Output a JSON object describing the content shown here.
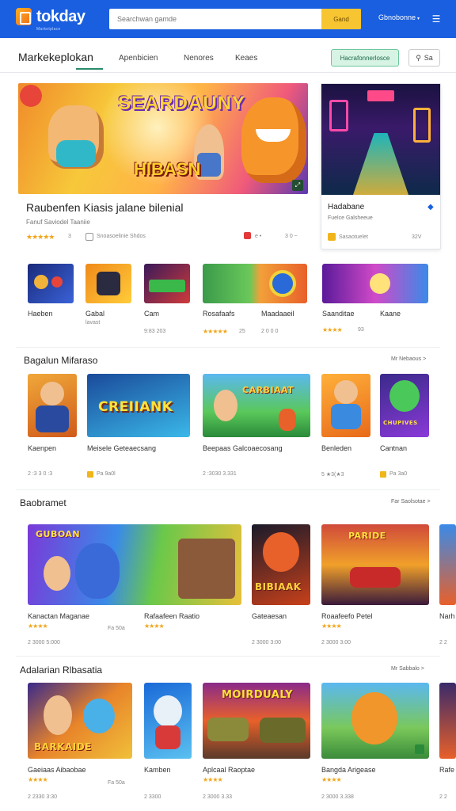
{
  "header": {
    "logo_text": "tokday",
    "logo_sub": "Marketplace",
    "search_placeholder": "Searchwan gamde",
    "search_button": "Gand",
    "account_label": "Gbnobonne",
    "menu_icon": "hamburger-icon"
  },
  "nav": {
    "brand": "Markekeplokan",
    "tabs": [
      "Apenbicien",
      "Nenores",
      "Keaes"
    ],
    "cta": "Hacrafonnerlosce",
    "search_label": "Sa"
  },
  "hero": {
    "art_title_top": "SEARDAUNY",
    "art_title_bottom": "HIBASN",
    "title": "Raubenfen Kiasis jalane bilenial",
    "desc": "Fanuf Saviodel Taaniie",
    "rating_stars": "★★★★★",
    "rating_num": "3",
    "meta": "Snoasoelinie Shdos",
    "tag_text": "e •",
    "count": "3 0 ~"
  },
  "side_card": {
    "title": "Hadabane",
    "desc": "Fuelce Galsheeue",
    "meta": "Sasaotuelet",
    "count": "32V"
  },
  "row1": {
    "tiles": [
      {
        "label": "Haeben",
        "sub": "",
        "stars": ""
      },
      {
        "label": "Gabal",
        "sub": "lavast",
        "stars": ""
      },
      {
        "label": "Cam",
        "sub": "9:83  203",
        "stars": ""
      },
      {
        "label": "Rosafaafs",
        "sub": "",
        "stars": "★★★★★",
        "extra": "25"
      },
      {
        "label": "Maadaaeil",
        "sub": "2 0 0 0",
        "stars": ""
      },
      {
        "label": "Saanditae",
        "sub": "",
        "stars": "★★★★",
        "extra": "93"
      },
      {
        "label": "Kaane",
        "sub": "",
        "stars": ""
      }
    ]
  },
  "section1": {
    "title": "Bagalun Mifaraso",
    "link": "Mr Nebaous  >",
    "tiles": [
      {
        "label": "Kaenpen",
        "sub": "2 :3 3 0 :3"
      },
      {
        "label": "Meisele Geteaecsang",
        "sub": "Pa  9a0l"
      },
      {
        "label": "Beepaas Galcoaecosang",
        "sub": "2 :3030 3.331"
      },
      {
        "label": "Benleden",
        "sub": "5 ★3(★3"
      },
      {
        "label": "Cantnan",
        "sub": "Pa  3a0"
      }
    ],
    "art": [
      "",
      "CREIIANK",
      "CARBIAAT",
      "",
      "CHUPIVES"
    ]
  },
  "section2": {
    "title": "Baobramet",
    "link": "Far Saolsotae  >",
    "tiles": [
      {
        "label": "Kanactan Maganae",
        "sub": "2 3000 5:000",
        "stars": "★★★★",
        "extra": "Fa 50a"
      },
      {
        "label": "Rafaafeen Raatio",
        "sub": "",
        "stars": "★★★★",
        "extra": ""
      },
      {
        "label": "Gateaesan",
        "sub": "2 3000 3:00",
        "stars": "",
        "extra": ""
      },
      {
        "label": "Roaafeefo Petel",
        "sub": "2 3000 3:00",
        "stars": "★★★★",
        "extra": ""
      },
      {
        "label": "Narh",
        "sub": "2 2",
        "stars": "",
        "extra": ""
      }
    ],
    "art": [
      "GUBOAN",
      "",
      "BIBIAAK",
      "PARIDE",
      ""
    ]
  },
  "section3": {
    "title": "Adalarian Rlbasatia",
    "link": "Mr Sabbalo  >",
    "tiles": [
      {
        "label": "Gaeiaas Aibaobae",
        "sub": "2 2330 3:30",
        "stars": "★★★★",
        "extra": "Fa 50a"
      },
      {
        "label": "Kamben",
        "sub": "2 3300",
        "stars": "",
        "extra": ""
      },
      {
        "label": "Aplcaal Raoptae",
        "sub": "2 3000 3.33",
        "stars": "★★★★",
        "extra": ""
      },
      {
        "label": "Bangda Arigease",
        "sub": "2 3000 3.338",
        "stars": "★★★★",
        "extra": ""
      },
      {
        "label": "Rafe",
        "sub": "2 2",
        "stars": "",
        "extra": ""
      }
    ],
    "art": [
      "BARKAIDE",
      "",
      "MOIRDUALY",
      "",
      ""
    ]
  },
  "colors": {
    "header_blue": "#1a5fe0",
    "search_yellow": "#f7c531",
    "cta_green": "#d7f3e4",
    "star": "#f0a51a"
  }
}
